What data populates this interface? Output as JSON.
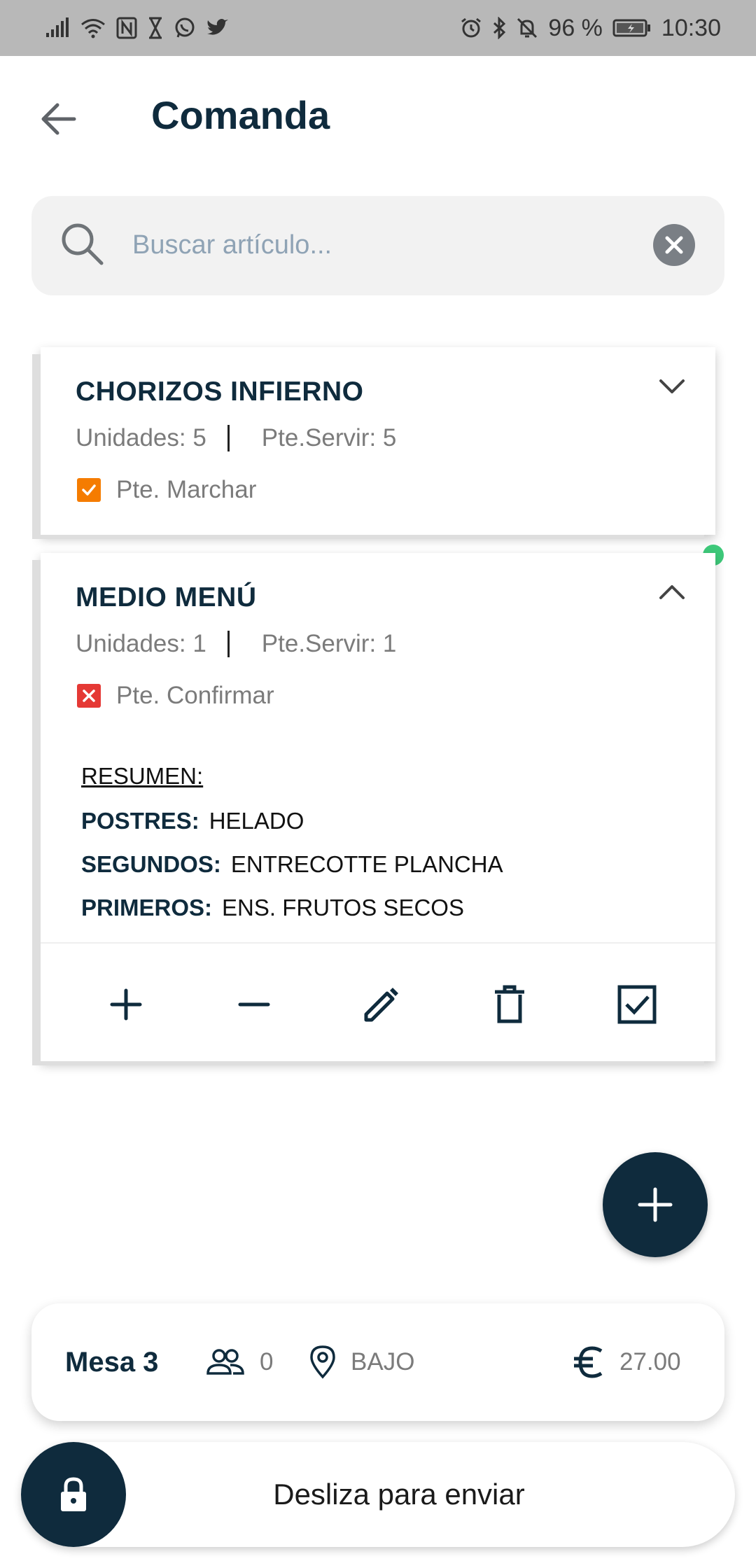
{
  "status_bar": {
    "battery": "96 %",
    "time": "10:30"
  },
  "header": {
    "title": "Comanda"
  },
  "search": {
    "placeholder": "Buscar artículo...",
    "value": ""
  },
  "orders": [
    {
      "name": "CHORIZOS INFIERNO",
      "units": "Unidades: 5",
      "pending_serve": "Pte.Servir: 5",
      "status": "Pte. Marchar",
      "status_color": "#f57c00",
      "expanded": false
    },
    {
      "name": "MEDIO MENÚ",
      "units": "Unidades: 1",
      "pending_serve": "Pte.Servir: 1",
      "status": "Pte. Confirmar",
      "status_color": "#e53935",
      "expanded": true,
      "summary": {
        "title": "RESUMEN:",
        "rows": [
          {
            "course": "POSTRES:",
            "dish": "HELADO"
          },
          {
            "course": "SEGUNDOS:",
            "dish": "ENTRECOTTE PLANCHA"
          },
          {
            "course": "PRIMEROS:",
            "dish": "ENS. FRUTOS SECOS"
          }
        ]
      }
    }
  ],
  "footer": {
    "table": "Mesa 3",
    "diners": "0",
    "zone": "BAJO",
    "total": "27.00"
  },
  "slider": {
    "label": "Desliza para enviar"
  },
  "colors": {
    "primary": "#0f2b3d",
    "online": "#3ec97a",
    "status_bar": "#b8b8b8"
  }
}
